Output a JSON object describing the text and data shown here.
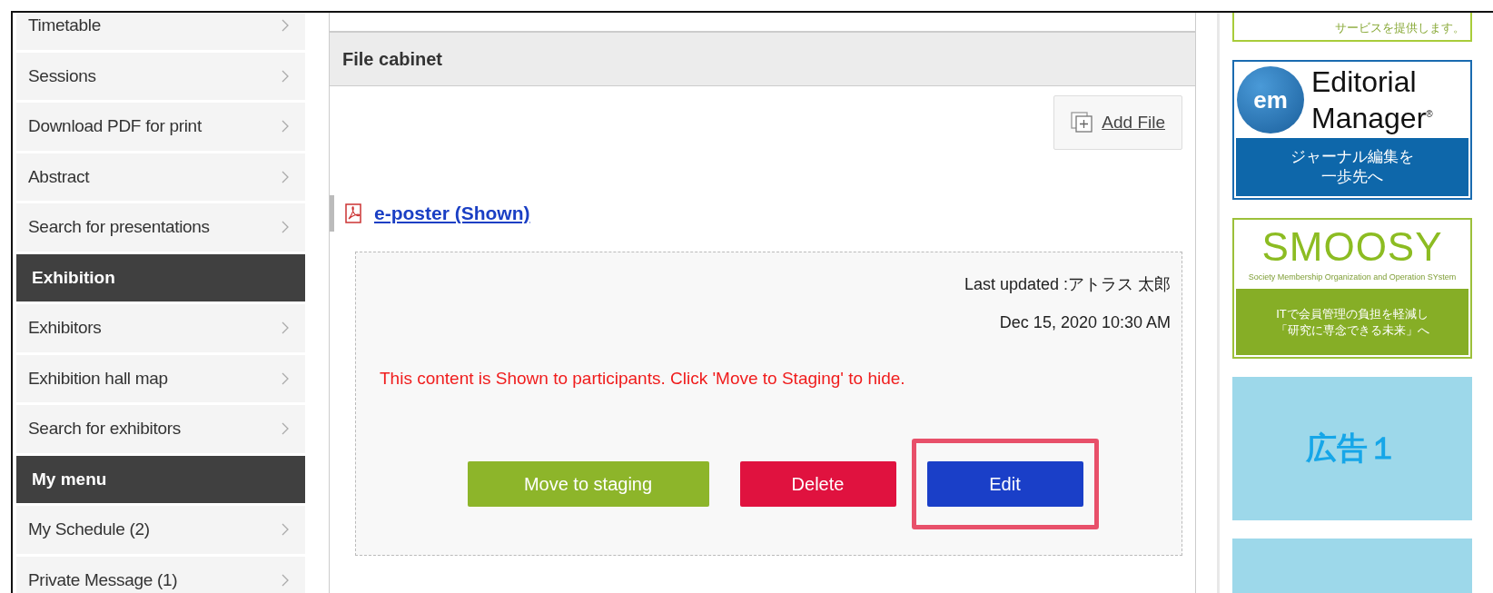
{
  "sidebar": {
    "items": [
      {
        "kind": "link",
        "label": "Timetable"
      },
      {
        "kind": "link",
        "label": "Sessions"
      },
      {
        "kind": "link",
        "label": "Download PDF for print"
      },
      {
        "kind": "link",
        "label": "Abstract"
      },
      {
        "kind": "link",
        "label": "Search for presentations"
      },
      {
        "kind": "heading",
        "label": "Exhibition"
      },
      {
        "kind": "link",
        "label": "Exhibitors"
      },
      {
        "kind": "link",
        "label": "Exhibition hall map"
      },
      {
        "kind": "link",
        "label": "Search for exhibitors"
      },
      {
        "kind": "heading",
        "label": "My menu"
      },
      {
        "kind": "link",
        "label": "My Schedule (2)"
      },
      {
        "kind": "link",
        "label": "Private Message (1)"
      }
    ]
  },
  "file_cabinet": {
    "title": "File cabinet",
    "add_button": "Add File",
    "file": {
      "name": "e-poster (Shown)",
      "last_updated": "Last updated :アトラス 太郎",
      "date": "Dec 15, 2020 10:30 AM",
      "notice": "This content is Shown to participants. Click 'Move to Staging' to hide.",
      "buttons": [
        {
          "kind": "stage",
          "label": "Move to staging",
          "highlighted": false
        },
        {
          "kind": "delete",
          "label": "Delete",
          "highlighted": false
        },
        {
          "kind": "edit",
          "label": "Edit",
          "highlighted": true
        }
      ]
    }
  },
  "ads": [
    {
      "kind": "text",
      "text": "サービスを提供します。"
    },
    {
      "kind": "editorial",
      "logo": "em",
      "title_1": "Editorial",
      "title_2": "Manager",
      "mark": "®",
      "caption_1": "ジャーナル編集を",
      "caption_2": "一歩先へ"
    },
    {
      "kind": "smoosy",
      "logo": "SMOOSY",
      "tagline": "Society Membership Organization and Operation SYstem",
      "caption_1": "ITで会員管理の負担を軽減し",
      "caption_2": "「研究に専念できる未来」へ"
    },
    {
      "kind": "placeholder",
      "label": "広告１"
    },
    {
      "kind": "placeholder"
    }
  ]
}
